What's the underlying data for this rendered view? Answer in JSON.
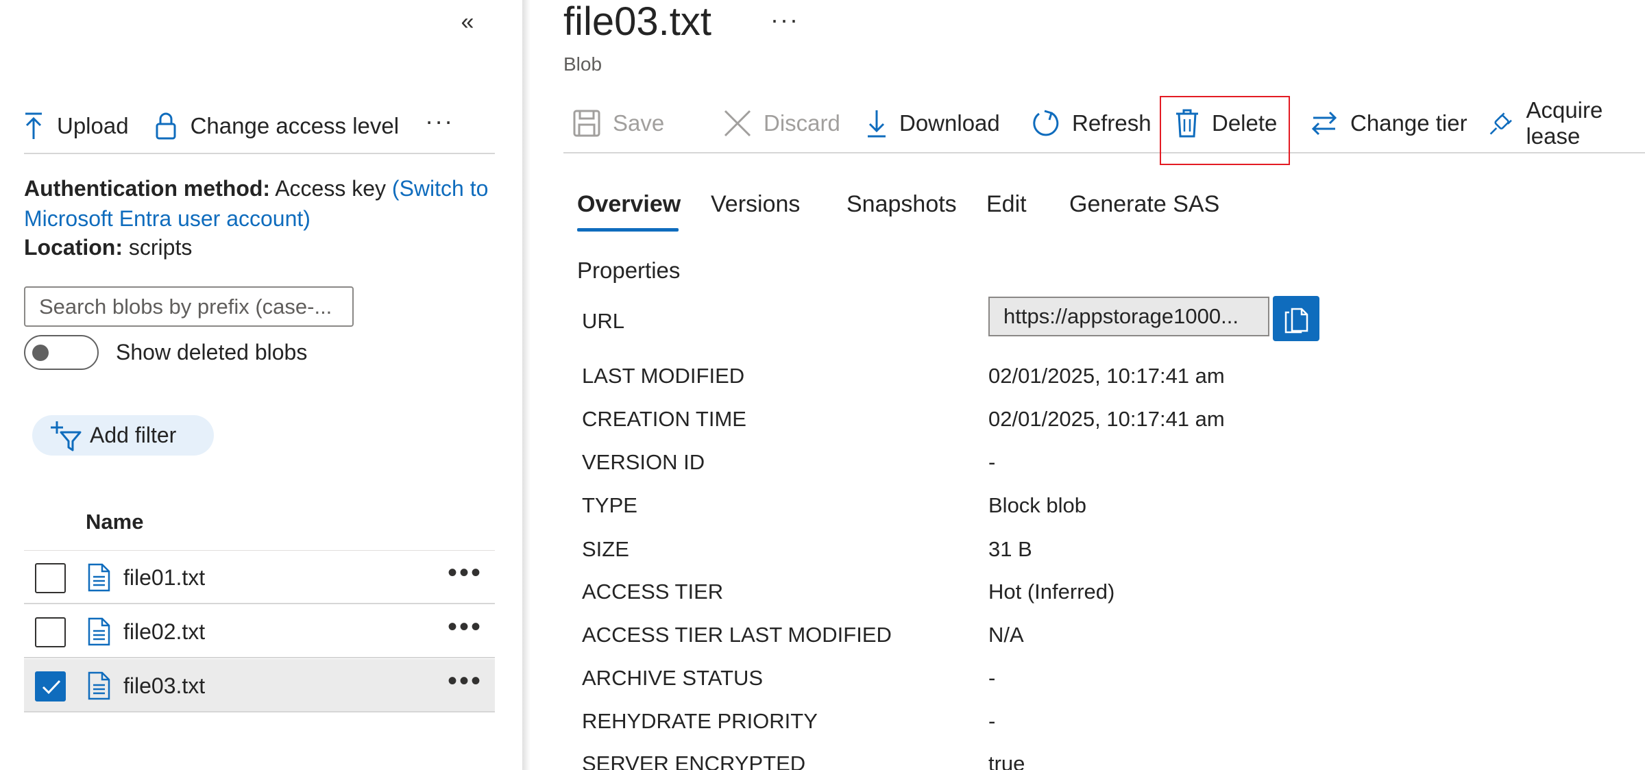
{
  "left": {
    "collapse_glyph": "«",
    "toolbar": {
      "upload": "Upload",
      "change_access": "Change access level",
      "more": "···"
    },
    "auth": {
      "label": "Authentication method:",
      "value": "Access key",
      "link": "(Switch to Microsoft Entra user account)"
    },
    "location": {
      "label": "Location:",
      "value": "scripts"
    },
    "search_placeholder": "Search blobs by prefix (case-...",
    "show_deleted": "Show deleted blobs",
    "add_filter": "Add filter",
    "list": {
      "header_name": "Name",
      "files": [
        {
          "name": "file01.txt",
          "selected": false
        },
        {
          "name": "file02.txt",
          "selected": false
        },
        {
          "name": "file03.txt",
          "selected": true
        }
      ],
      "more": "•••"
    }
  },
  "right": {
    "title": "file03.txt",
    "title_more": "···",
    "subtitle": "Blob",
    "commands": {
      "save": "Save",
      "discard": "Discard",
      "download": "Download",
      "refresh": "Refresh",
      "delete": "Delete",
      "change_tier": "Change tier",
      "acquire_lease": "Acquire lease"
    },
    "tabs": [
      "Overview",
      "Versions",
      "Snapshots",
      "Edit",
      "Generate SAS"
    ],
    "properties_title": "Properties",
    "url_label": "URL",
    "url_value": "https://appstorage1000...",
    "properties": [
      {
        "label": "LAST MODIFIED",
        "value": "02/01/2025, 10:17:41 am"
      },
      {
        "label": "CREATION TIME",
        "value": "02/01/2025, 10:17:41 am"
      },
      {
        "label": "VERSION ID",
        "value": "-"
      },
      {
        "label": "TYPE",
        "value": "Block blob"
      },
      {
        "label": "SIZE",
        "value": "31 B"
      },
      {
        "label": "ACCESS TIER",
        "value": "Hot (Inferred)"
      },
      {
        "label": "ACCESS TIER LAST MODIFIED",
        "value": "N/A"
      },
      {
        "label": "ARCHIVE STATUS",
        "value": "-"
      },
      {
        "label": "REHYDRATE PRIORITY",
        "value": "-"
      },
      {
        "label": "SERVER ENCRYPTED",
        "value": "true"
      }
    ]
  },
  "colors": {
    "accent": "#0f6cbd",
    "highlight_border": "#e31b23",
    "selected_row": "#ebebeb"
  }
}
